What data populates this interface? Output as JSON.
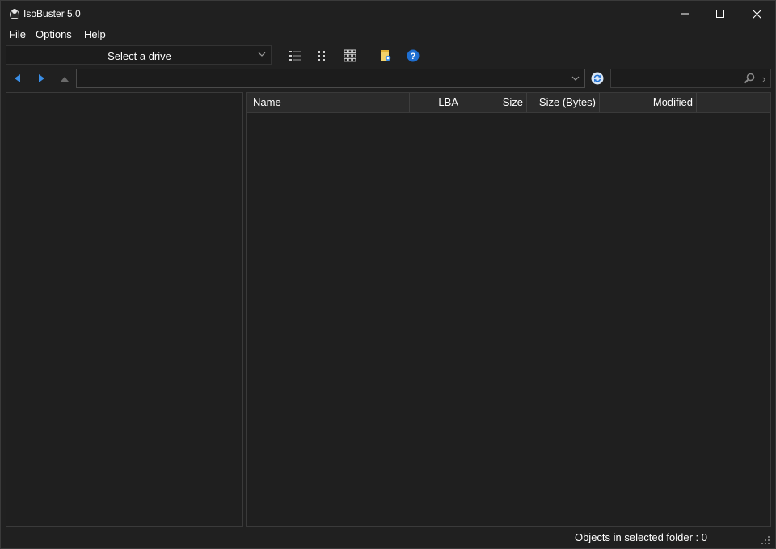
{
  "window": {
    "title": "IsoBuster 5.0"
  },
  "menu": {
    "items": [
      {
        "label": "File"
      },
      {
        "label": "Options"
      },
      {
        "label": "Help"
      }
    ]
  },
  "toolbar": {
    "drive_select": {
      "selected": "Select a drive"
    },
    "icons": [
      "details-view-icon",
      "list-view-icon",
      "icon-view-icon",
      "notes-icon",
      "help-icon"
    ]
  },
  "address": {
    "value": ""
  },
  "search": {
    "value": ""
  },
  "file_list": {
    "columns": [
      {
        "label": "Name"
      },
      {
        "label": "LBA"
      },
      {
        "label": "Size"
      },
      {
        "label": "Size (Bytes)"
      },
      {
        "label": "Modified"
      }
    ],
    "rows": []
  },
  "status": {
    "text": "Objects in selected folder : 0"
  },
  "colors": {
    "background": "#202020",
    "accent_blue": "#3a8ee6",
    "header_bg": "#2b2b2b"
  }
}
